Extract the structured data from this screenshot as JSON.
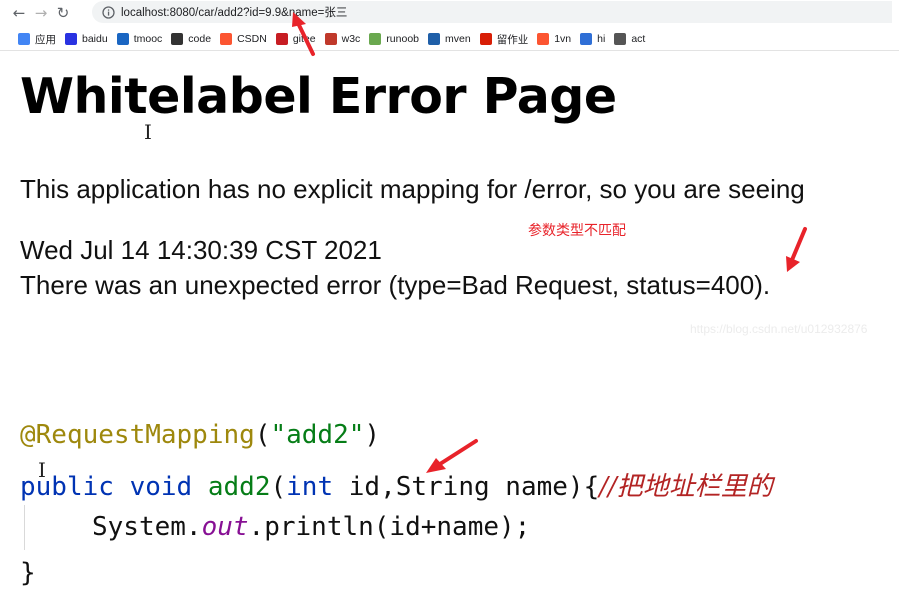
{
  "browser": {
    "url": "localhost:8080/car/add2?id=9.9&name=张三",
    "bookmarks": [
      {
        "label": "应用",
        "icon": "apps-grid-icon",
        "color": "#4285f4"
      },
      {
        "label": "baidu",
        "icon": "baidu-paw-icon",
        "color": "#2932e1"
      },
      {
        "label": "tmooc",
        "icon": "tmooc-icon",
        "color": "#1a66c2"
      },
      {
        "label": "code",
        "icon": "code-icon",
        "color": "#333333"
      },
      {
        "label": "CSDN",
        "icon": "csdn-icon",
        "color": "#fc5531"
      },
      {
        "label": "gitee",
        "icon": "gitee-icon",
        "color": "#c71d23"
      },
      {
        "label": "w3c",
        "icon": "w3c-icon",
        "color": "#c0392b"
      },
      {
        "label": "runoob",
        "icon": "runoob-icon",
        "color": "#6aa84f"
      },
      {
        "label": "mven",
        "icon": "mvn-icon",
        "color": "#1f5fa8"
      },
      {
        "label": "留作业",
        "icon": "tmooc-icon",
        "color": "#d81e06"
      },
      {
        "label": "1vn",
        "icon": "csdn-icon",
        "color": "#fc5531"
      },
      {
        "label": "hi",
        "icon": "hi-icon",
        "color": "#2f6fd6"
      },
      {
        "label": "act",
        "icon": "act-icon",
        "color": "#555555"
      }
    ]
  },
  "page": {
    "title": "Whitelabel Error Page",
    "message": "This application has no explicit mapping for /error, so you are seeing",
    "timestamp": "Wed Jul 14 14:30:39 CST 2021",
    "error_line": "There was an unexpected error (type=Bad Request, status=400).",
    "annotation_note": "参数类型不匹配",
    "watermark": "https://blog.csdn.net/u012932876"
  },
  "code": {
    "line1": {
      "annotation": "@RequestMapping",
      "open": "(",
      "string": "\"add2\"",
      "close": ")"
    },
    "line2": {
      "kw1": "public",
      "kw2": "void",
      "method": "add2",
      "open": "(",
      "kw3": "int",
      "params": " id,String name){",
      "comment": "//把地址栏里的"
    },
    "line3": {
      "cls": "System.",
      "field": "out",
      "call": ".println(id+name);"
    },
    "line4": {
      "brace": "}"
    }
  },
  "colors": {
    "arrow": "#e8232a",
    "annotation": "#9e880d",
    "string": "#067d17",
    "keyword": "#0033b3",
    "field": "#871094",
    "comment": "#b32424"
  }
}
